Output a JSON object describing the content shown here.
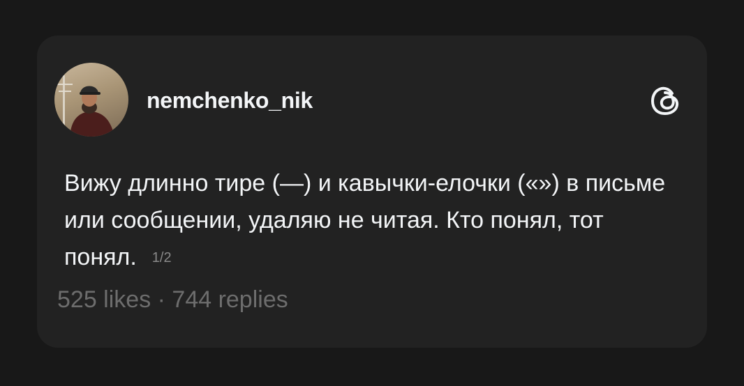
{
  "post": {
    "username": "nemchenko_nik",
    "text": "Вижу длинно тире (—) и кавычки-елочки («») в письме или сообщении, удаляю не читая. Кто понял, тот понял.",
    "page_indicator": "1/2",
    "stats": "525 likes · 744 replies"
  },
  "icons": {
    "avatar": "user-avatar-photo",
    "logo": "threads-logo-icon"
  },
  "colors": {
    "background": "#181818",
    "card": "#222222",
    "text": "#f3f5f7",
    "muted": "#6d6d6d"
  }
}
